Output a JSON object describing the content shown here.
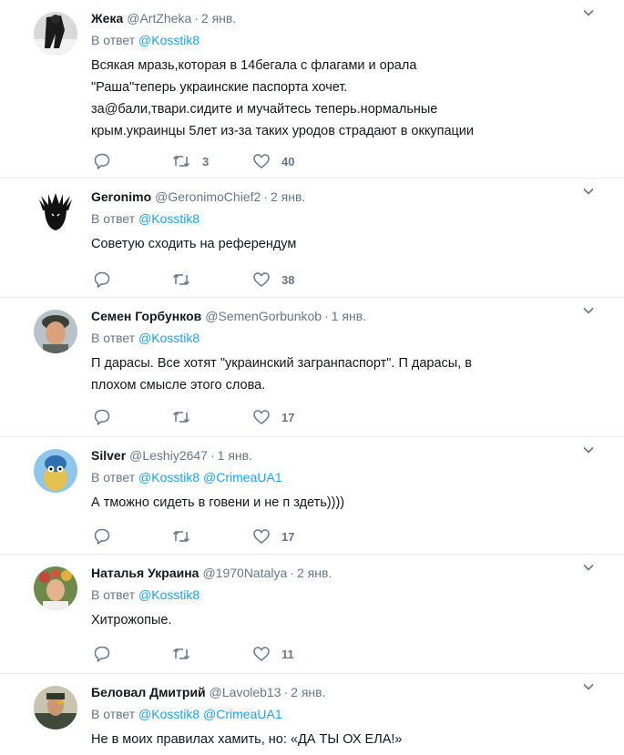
{
  "reply_prefix": "В ответ",
  "tweets": [
    {
      "fullname": "Жека",
      "username": "@ArtZheka",
      "time": "2 янв.",
      "mentions": [
        "@Kosstik8"
      ],
      "text": "Всякая мразь,которая в 14бегала с флагами и орала \"Раша\"теперь украинские паспорта хочет. за@бали,твари.сидите и мучайтесь теперь.нормальные крым.украинцы 5лет из-за таких уродов страдают в оккупации",
      "replies": "",
      "retweets": "3",
      "likes": "40"
    },
    {
      "fullname": "Geronimo",
      "username": "@GeronimoChief2",
      "time": "2 янв.",
      "mentions": [
        "@Kosstik8"
      ],
      "text": "Советую сходить на референдум",
      "replies": "",
      "retweets": "",
      "likes": "38"
    },
    {
      "fullname": "Семен Горбунков",
      "username": "@SemenGorbunkob",
      "time": "1 янв.",
      "mentions": [
        "@Kosstik8"
      ],
      "text": "П   дарасы. Все хотят \"украинский загранпаспорт\". П   дарасы, в плохом смысле этого слова.",
      "replies": "",
      "retweets": "",
      "likes": "17"
    },
    {
      "fullname": "Silver",
      "username": "@Leshiy2647",
      "time": "1 янв.",
      "mentions": [
        "@Kosstik8",
        "@CrimeaUA1"
      ],
      "text": "А тможно сидеть в говени и не п   здеть))))",
      "replies": "",
      "retweets": "",
      "likes": "17"
    },
    {
      "fullname": "Наталья Украина",
      "username": "@1970Natalya",
      "time": "2 янв.",
      "mentions": [
        "@Kosstik8"
      ],
      "text": "Хитрожопые.",
      "replies": "",
      "retweets": "",
      "likes": "11"
    },
    {
      "fullname": "Беловал Дмитрий",
      "username": "@Lavoleb13",
      "time": "2 янв.",
      "mentions": [
        "@Kosstik8",
        "@CrimeaUA1"
      ],
      "text": "Не в моих правилах хамить, но: «ДА ТЫ ОХ  ЕЛА!»",
      "replies": "",
      "retweets": "",
      "likes": ""
    }
  ],
  "colors": {
    "link": "#1da1f2",
    "secondary": "#657786",
    "text": "#14171a",
    "divider": "#e6ecf0",
    "icon": "#657786"
  }
}
